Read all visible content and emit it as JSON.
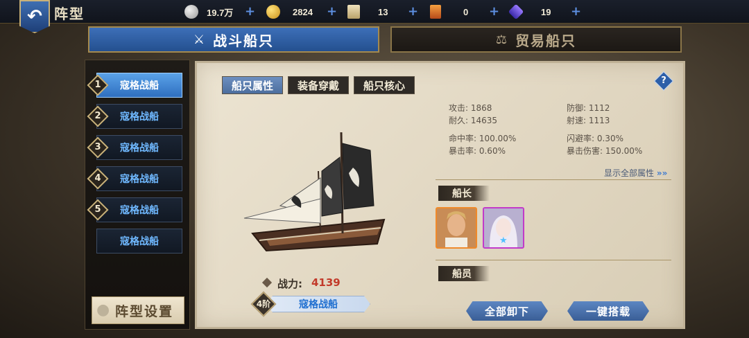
{
  "header": {
    "title": "阵型",
    "back_icon": "back-arrow-icon"
  },
  "resources": [
    {
      "icon": "silver-coin-icon",
      "value": "19.7万",
      "color": "#c9c9c9"
    },
    {
      "icon": "gold-coin-icon",
      "value": "2824",
      "color": "#f2c230"
    },
    {
      "icon": "scroll-icon",
      "value": "13",
      "color": "#d8c9a0"
    },
    {
      "icon": "card-icon",
      "value": "0",
      "color": "#e0702a"
    },
    {
      "icon": "gem-icon",
      "value": "19",
      "color": "#6a4ad8"
    }
  ],
  "main_tabs": {
    "battle": "战斗船只",
    "trade": "贸易船只"
  },
  "ship_slots": [
    {
      "num": "1",
      "label": "寇格战船"
    },
    {
      "num": "2",
      "label": "寇格战船"
    },
    {
      "num": "3",
      "label": "寇格战船"
    },
    {
      "num": "4",
      "label": "寇格战船"
    },
    {
      "num": "5",
      "label": "寇格战船"
    },
    {
      "num": "",
      "label": "寇格战船"
    }
  ],
  "formation_button": "阵型设置",
  "sub_tabs": [
    "船只属性",
    "装备穿戴",
    "船只核心"
  ],
  "help_label": "?",
  "stats": {
    "attack": "攻击: 1868",
    "defense": "防御: 1112",
    "durability": "耐久: 14635",
    "fire_rate": "射速: 1113",
    "hit_rate": "命中率: 100.00%",
    "dodge_rate": "闪避率: 0.30%",
    "crit_rate": "暴击率: 0.60%",
    "crit_damage": "暴击伤害: 150.00%"
  },
  "show_all": "显示全部属性",
  "captain_label": "船长",
  "crew_label": "船员",
  "power": {
    "label": "战力:",
    "value": "4139"
  },
  "ship": {
    "tier": "4阶",
    "name": "寇格战船"
  },
  "buttons": {
    "unload_all": "全部卸下",
    "one_click_load": "一键搭载"
  }
}
